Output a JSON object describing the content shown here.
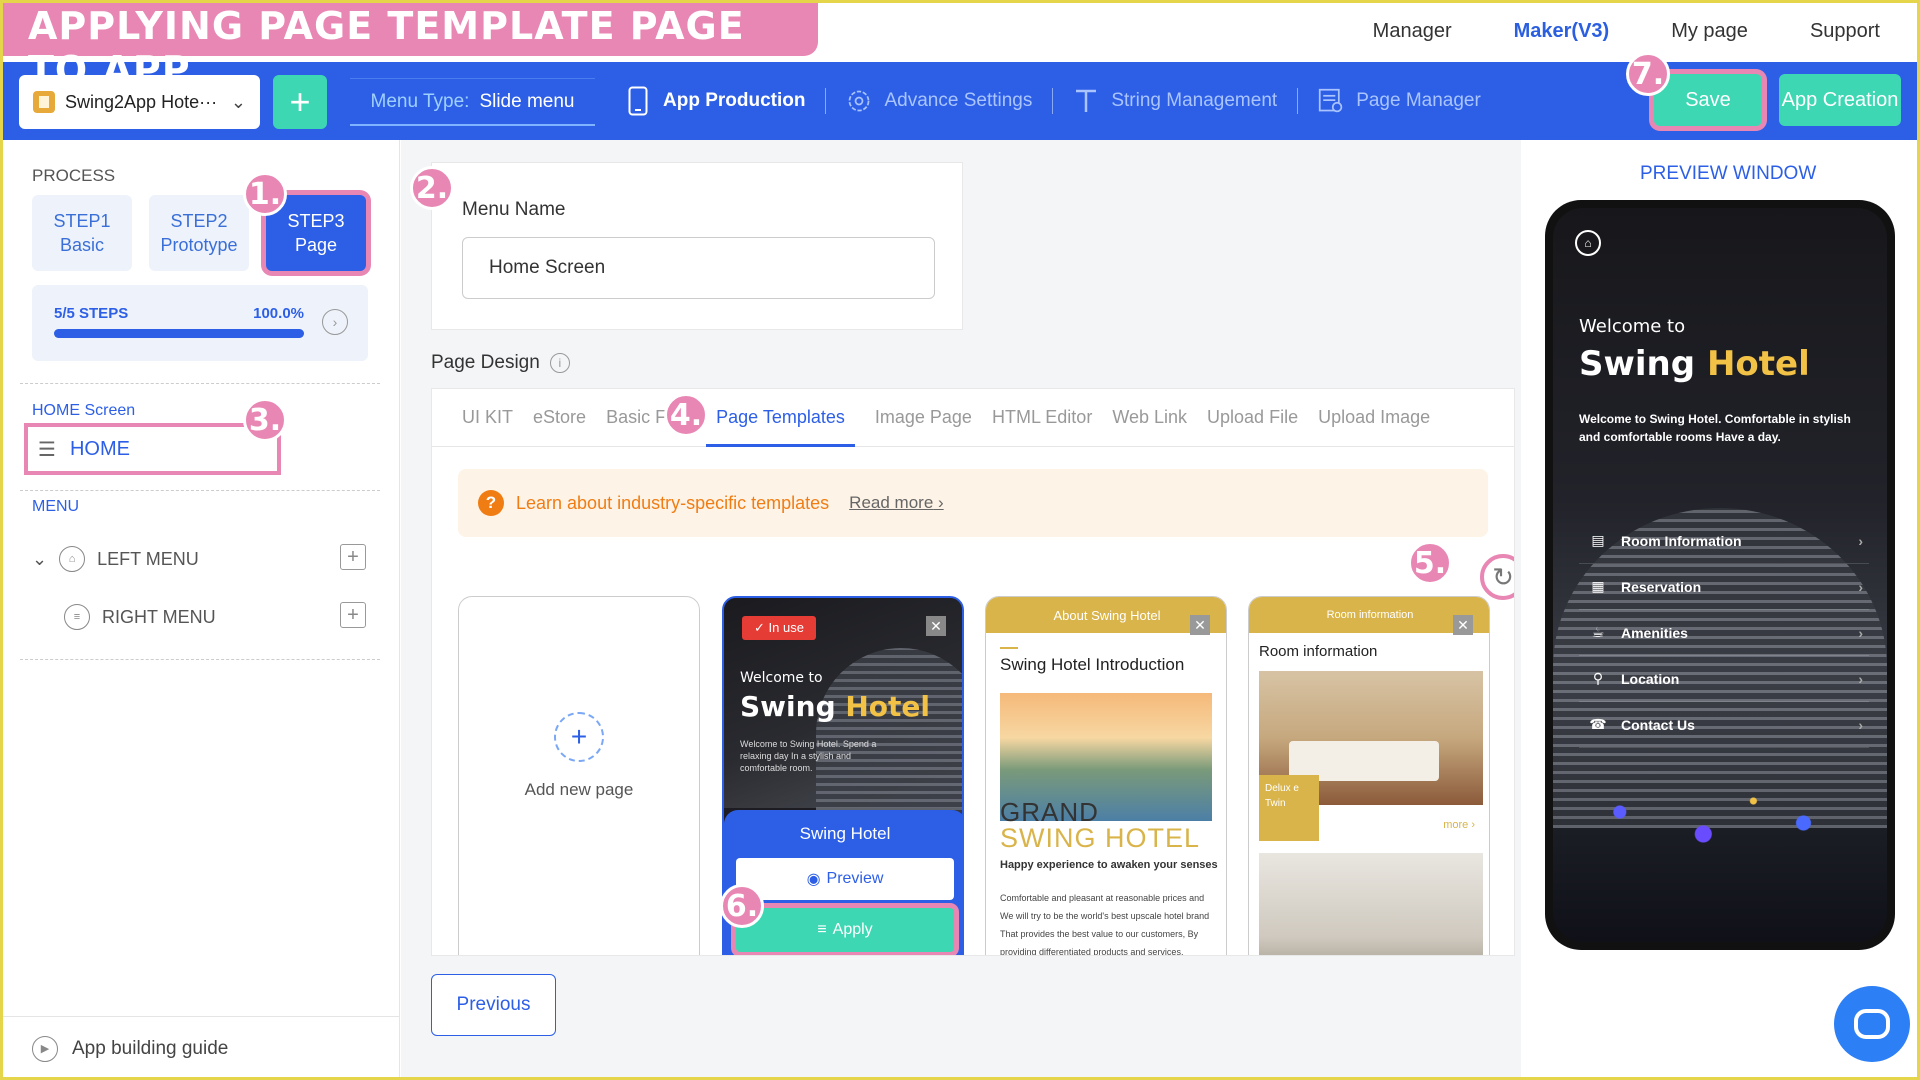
{
  "banner": {
    "title": "APPLYING PAGE TEMPLATE PAGE TO APP"
  },
  "topnav": {
    "items": [
      "Manager",
      "Maker(V3)",
      "My page",
      "Support"
    ]
  },
  "toolbar": {
    "app_name": "Swing2App Hote···",
    "add_label": "+",
    "menu_type_label": "Menu Type:",
    "menu_type_value": "Slide menu",
    "items": [
      "App Production",
      "Advance Settings",
      "String Management",
      "Page Manager"
    ],
    "save_label": "Save",
    "creation_label": "App Creation"
  },
  "markers": [
    "1.",
    "2.",
    "3.",
    "4.",
    "5.",
    "6.",
    "7."
  ],
  "left": {
    "process_label": "PROCESS",
    "steps": [
      {
        "line1": "STEP1",
        "line2": "Basic"
      },
      {
        "line1": "STEP2",
        "line2": "Prototype"
      },
      {
        "line1": "STEP3",
        "line2": "Page"
      }
    ],
    "progress_label": "5/5 STEPS",
    "progress_value": "100.0%",
    "progress_fraction": 1.0,
    "home_screen_label": "HOME Screen",
    "home_item": "HOME",
    "menu_label": "MENU",
    "left_menu": "LEFT MENU",
    "right_menu": "RIGHT MENU",
    "guide_label": "App building guide"
  },
  "main": {
    "menu_name_label": "Menu Name",
    "menu_name_value": "Home Screen",
    "page_design_label": "Page Design",
    "tabs": [
      "UI KIT",
      "eStore",
      "Basic Fea",
      "Page Templates",
      "Image Page",
      "HTML Editor",
      "Web Link",
      "Upload File",
      "Upload Image"
    ],
    "notice_text": "Learn about industry-specific templates",
    "notice_more": "Read more",
    "add_new_page": "Add new page",
    "hotel_tpl": {
      "badge": "In use",
      "welcome": "Welcome to",
      "title_a": "Swing",
      "title_b": "Hotel",
      "small": "Welcome to Swing Hotel. Spend a relaxing day In a stylish and comfortable room.",
      "name": "Swing Hotel",
      "preview": "Preview",
      "apply": "Apply"
    },
    "about_tpl": {
      "head": "About Swing Hotel",
      "title": "Swing Hotel Introduction",
      "grand": "GRAND",
      "swing": "SWING HOTEL",
      "tagline": "Happy experience to awaken your senses",
      "body": "Comfortable and pleasant at reasonable prices and We will try to be the world's best upscale hotel brand That provides the best value to our customers, By providing differentiated products and services,"
    },
    "room_tpl": {
      "head": "Room information",
      "title": "Room information",
      "delux": "Delux e Twin",
      "more": "more"
    },
    "previous_label": "Previous"
  },
  "preview": {
    "title": "PREVIEW WINDOW",
    "welcome": "Welcome to",
    "title_a": "Swing",
    "title_b": "Hotel",
    "text": "Welcome to Swing Hotel. Comfortable in stylish and comfortable rooms Have a day.",
    "menu": [
      "Room Information",
      "Reservation",
      "Amenities",
      "Location",
      "Contact Us"
    ]
  },
  "colors": {
    "primary": "#2d5fe6",
    "accent": "#3ed7b3",
    "highlight": "#e887b4",
    "gold": "#d9b44a"
  }
}
